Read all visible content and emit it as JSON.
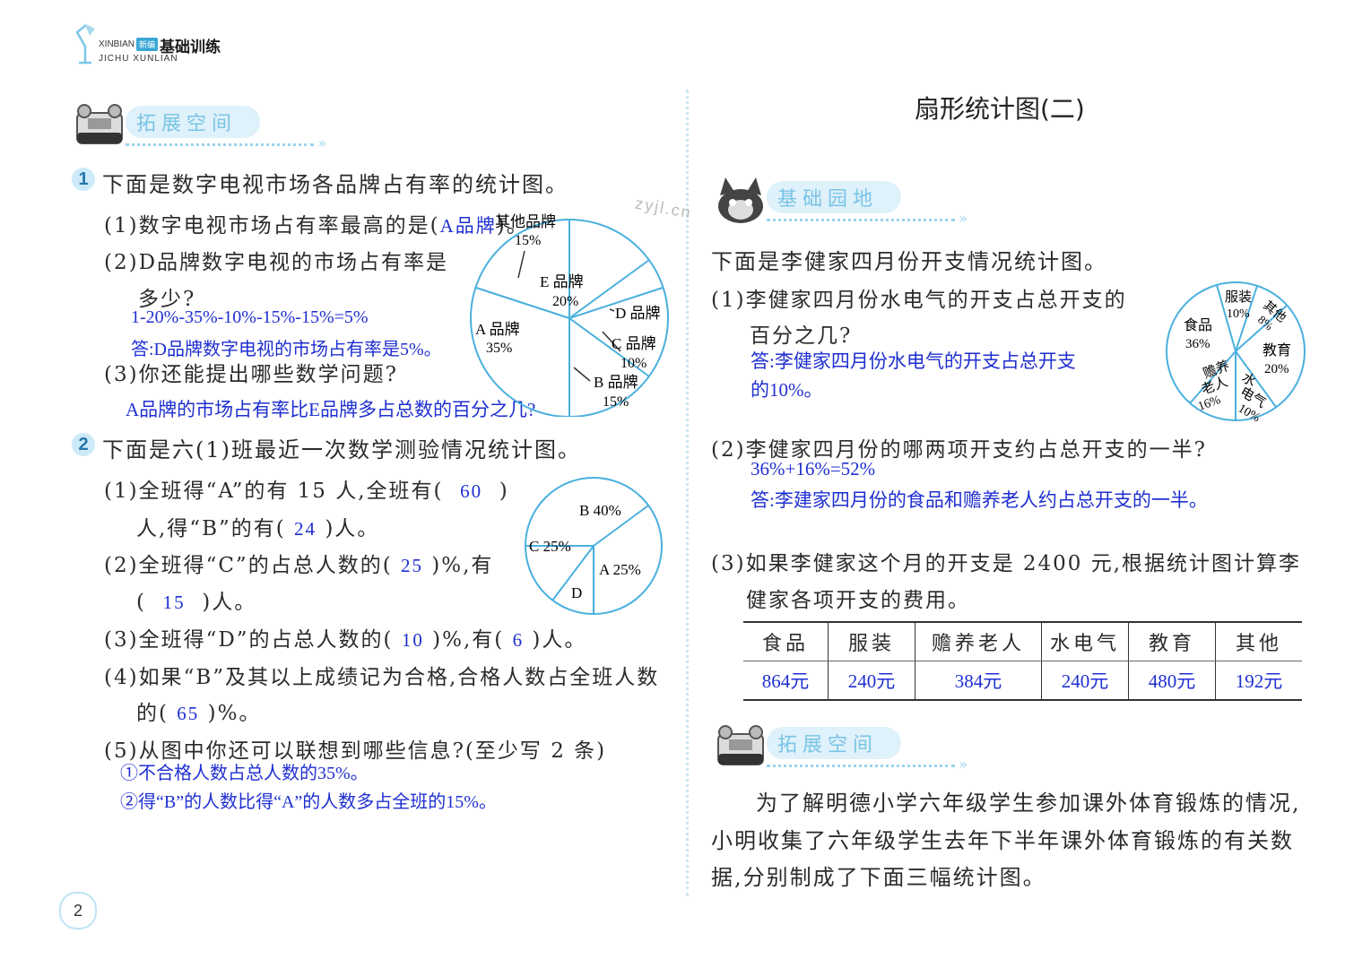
{
  "header": {
    "pinyin_line1": "XINBIAN",
    "badge": "新编",
    "title": "基础训练",
    "pinyin_line2": "JICHU XUNLIAN"
  },
  "left": {
    "section_title": "拓展空间",
    "q1": {
      "number": "1",
      "title": "下面是数字电视市场各品牌占有率的统计图。",
      "p1": "(1)数字电视市场占有率最高的是(",
      "p1_answer": "A品牌",
      "p1_end": ")。",
      "p2_a": "(2)D品牌数字电视的市场占有率是",
      "p2_b": "多少?",
      "p2_calc": "1-20%-35%-10%-15%-15%=5%",
      "p2_answer": "答:D品牌数字电视的市场占有率是5%。",
      "p3": "(3)你还能提出哪些数学问题?",
      "p3_answer": "A品牌的市场占有率比E品牌多占总数的百分之几?"
    },
    "pie1_labels": {
      "other": "其他品牌",
      "other_pct": "15%",
      "e": "E 品牌",
      "e_pct": "20%",
      "d": "D 品牌",
      "c": "C 品牌",
      "c_pct": "10%",
      "a": "A 品牌",
      "a_pct": "35%",
      "b": "B 品牌",
      "b_pct": "15%"
    },
    "q2": {
      "number": "2",
      "title": "下面是六(1)班最近一次数学测验情况统计图。",
      "p1_a": "(1)全班得“A”的有 15 人,全班有(",
      "p1_blank1": "60",
      "p1_b": ")",
      "p1_c": "人,得“B”的有(",
      "p1_blank2": "24",
      "p1_d": ")人。",
      "p2_a": "(2)全班得“C”的占总人数的(",
      "p2_blank1": "25",
      "p2_b": ")%,有",
      "p2_c": "(",
      "p2_blank2": "15",
      "p2_d": ")人。",
      "p3_a": "(3)全班得“D”的占总人数的(",
      "p3_blank1": "10",
      "p3_b": ")%,有(",
      "p3_blank2": "6",
      "p3_c": ")人。",
      "p4_a": "(4)如果“B”及其以上成绩记为合格,合格人数占全班人数",
      "p4_b": "的(",
      "p4_blank": "65",
      "p4_c": ")%。",
      "p5": "(5)从图中你还可以联想到哪些信息?(至少写 2 条)",
      "p5_ans1": "①不合格人数占总人数的35%。",
      "p5_ans2": "②得“B”的人数比得“A”的人数多占全班的15%。"
    },
    "pie2_labels": {
      "b": "B 40%",
      "c": "C 25%",
      "a": "A 25%",
      "d": "D"
    },
    "page_number": "2"
  },
  "right": {
    "title": "扇形统计图(二)",
    "section_title": "基础园地",
    "watermark": "zyjl.cn",
    "intro": "下面是李健家四月份开支情况统计图。",
    "q1_a": "(1)李健家四月份水电气的开支占总开支的",
    "q1_b": "百分之几?",
    "q1_ans1": "答:李健家四月份水电气的开支占总开支",
    "q1_ans2": "的10%。",
    "q2": "(2)李健家四月份的哪两项开支约占总开支的一半?",
    "q2_calc": "36%+16%=52%",
    "q2_ans": "答:李建家四月份的食品和赡养老人约占总开支的一半。",
    "q3_a": "(3)如果李健家这个月的开支是 2400 元,根据统计图计算李",
    "q3_b": "健家各项开支的费用。",
    "table": {
      "headers": [
        "食品",
        "服装",
        "赡养老人",
        "水电气",
        "教育",
        "其他"
      ],
      "values": [
        "864元",
        "240元",
        "384元",
        "240元",
        "480元",
        "192元"
      ]
    },
    "pie3_labels": {
      "clothes": "服装",
      "clothes_pct": "10%",
      "other": "其他",
      "other_pct": "8%",
      "food": "食品",
      "food_pct": "36%",
      "edu": "教育",
      "edu_pct": "20%",
      "elder_1": "赡养",
      "elder_2": "老人",
      "elder_pct": "16%",
      "util_1": "水",
      "util_2": "电气",
      "util_pct": "10%"
    },
    "section2_title": "拓展空间",
    "para_1": "为了解明德小学六年级学生参加课外体育锻炼的情况,",
    "para_2": "小明收集了六年级学生去年下半年课外体育锻炼的有关数",
    "para_3": "据,分别制成了下面三幅统计图。"
  },
  "colors": {
    "answer_blue": "#1f2fd0",
    "accent_light_blue": "#7ac4e6",
    "pie_stroke": "#4ab0de"
  }
}
